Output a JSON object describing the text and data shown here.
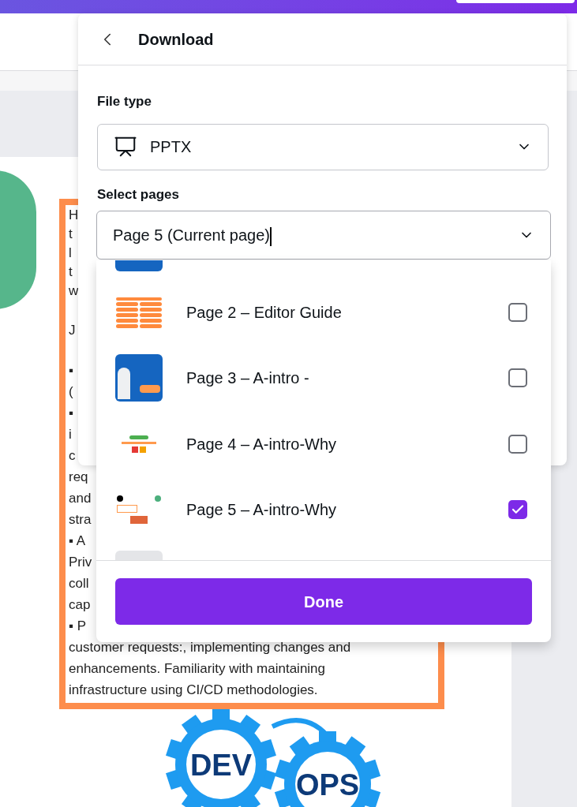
{
  "document": {
    "paragraphs": [
      [
        "H",
        "t",
        "l",
        "t",
        "w"
      ],
      [
        "J"
      ],
      [
        "▪",
        "(",
        "▪",
        "i",
        "c",
        "req",
        "and",
        "stra",
        "▪ A",
        "Priv",
        "coll",
        "cap",
        "▪ P",
        "customer requests:, implementing changes and",
        "enhancements. Familiarity with maintaining",
        "infrastructure using CI/CD methodologies."
      ]
    ],
    "logo": {
      "left": "DEV",
      "right": "OPS"
    }
  },
  "panel": {
    "title": "Download",
    "file_type": {
      "label": "File type",
      "value": "PPTX"
    },
    "select_pages": {
      "label": "Select pages",
      "value": "Page 5 (Current page)"
    },
    "pages": [
      {
        "kind": "partial",
        "thumbnail": {
          "kind": "blue"
        }
      },
      {
        "kind": "page",
        "label": "Page 2 – Editor Guide",
        "thumbnail": {
          "kind": "list"
        },
        "checked": false
      },
      {
        "kind": "page",
        "label": "Page 3 – A-intro -",
        "thumbnail": {
          "kind": "photo"
        },
        "checked": false
      },
      {
        "kind": "page",
        "label": "Page 4 – A-intro-Why",
        "thumbnail": {
          "kind": "icons"
        },
        "checked": false
      },
      {
        "kind": "page",
        "label": "Page 5 – A-intro-Why",
        "thumbnail": {
          "kind": "steps"
        },
        "checked": true
      },
      {
        "kind": "partial",
        "thumbnail": {
          "kind": "grey"
        }
      }
    ],
    "done": "Done"
  }
}
